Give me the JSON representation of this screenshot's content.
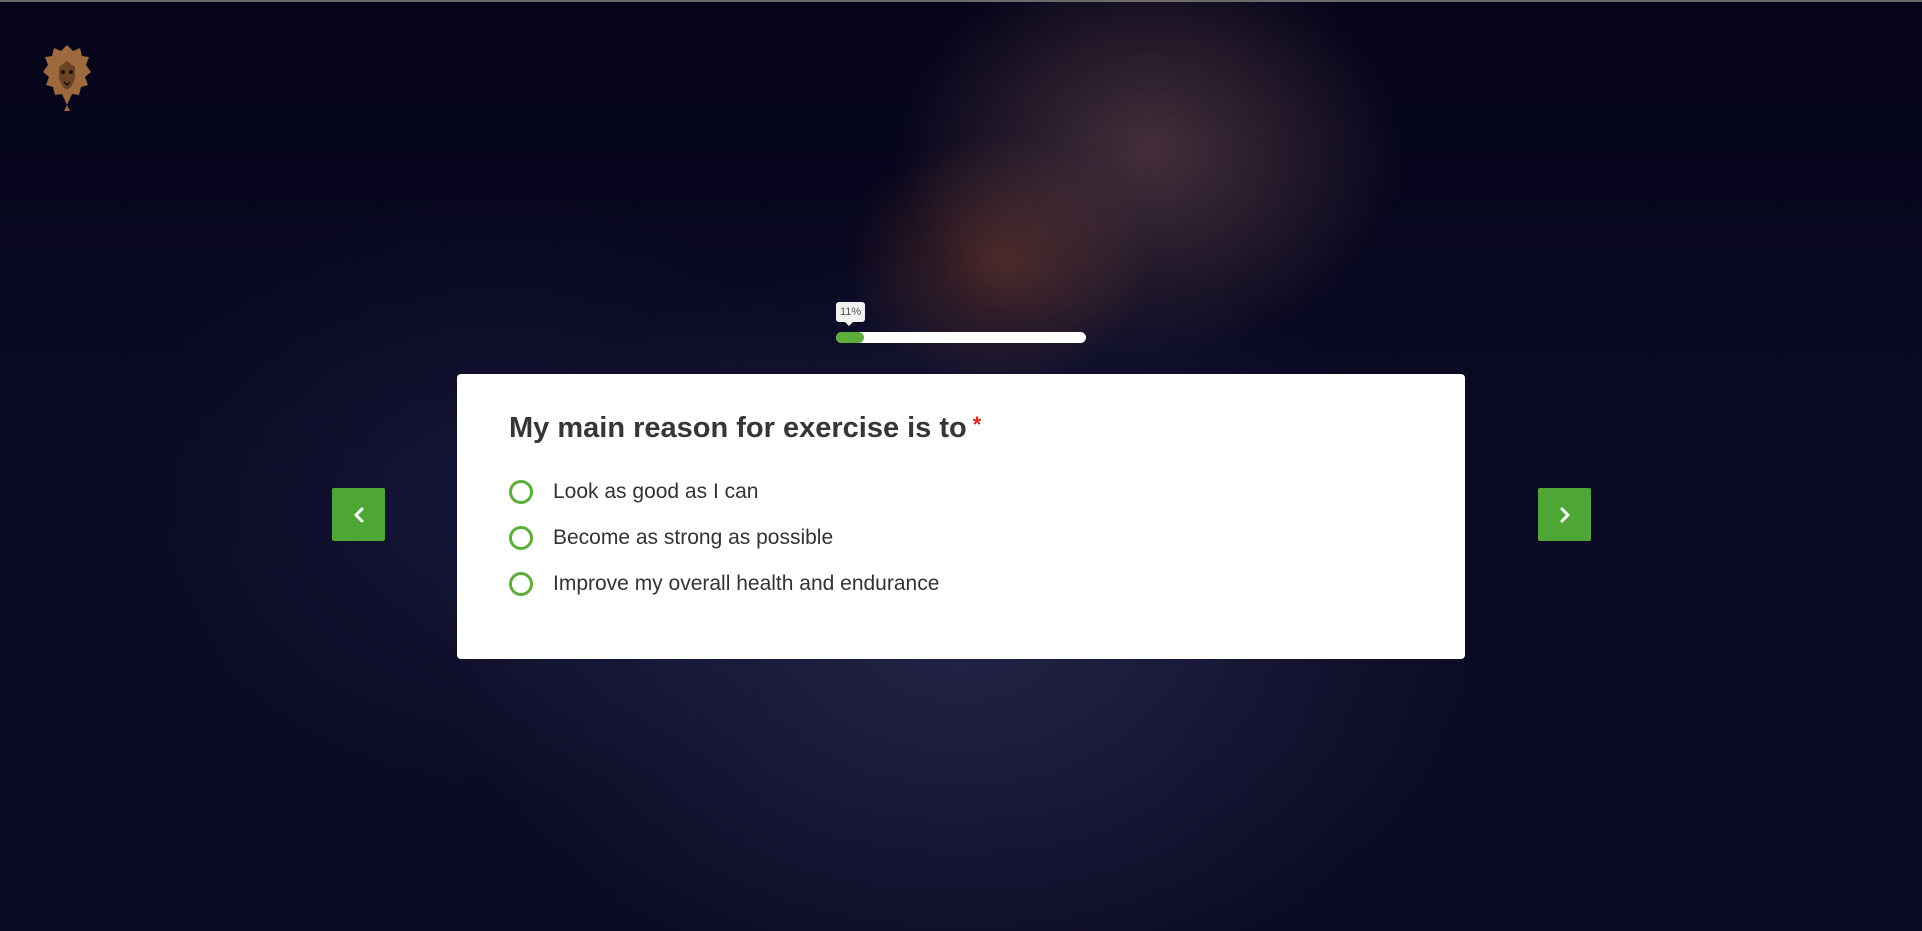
{
  "progress": {
    "label": "11%",
    "value": 0.11
  },
  "question": {
    "title": "My main reason for exercise is to",
    "required_marker": "*",
    "options": [
      {
        "label": "Look as good as I can"
      },
      {
        "label": "Become as strong as possible"
      },
      {
        "label": "Improve my overall health and endurance"
      }
    ]
  },
  "navigation": {
    "prev_icon": "chevron-left-icon",
    "next_icon": "chevron-right-icon"
  },
  "branding": {
    "logo_icon": "lion-head-icon"
  },
  "colors": {
    "accent": "#4ea635",
    "radio_border": "#5cae3a",
    "required": "#e02020",
    "card_bg": "#ffffff",
    "background": "#07061a",
    "logo": "#9c6a3c"
  }
}
